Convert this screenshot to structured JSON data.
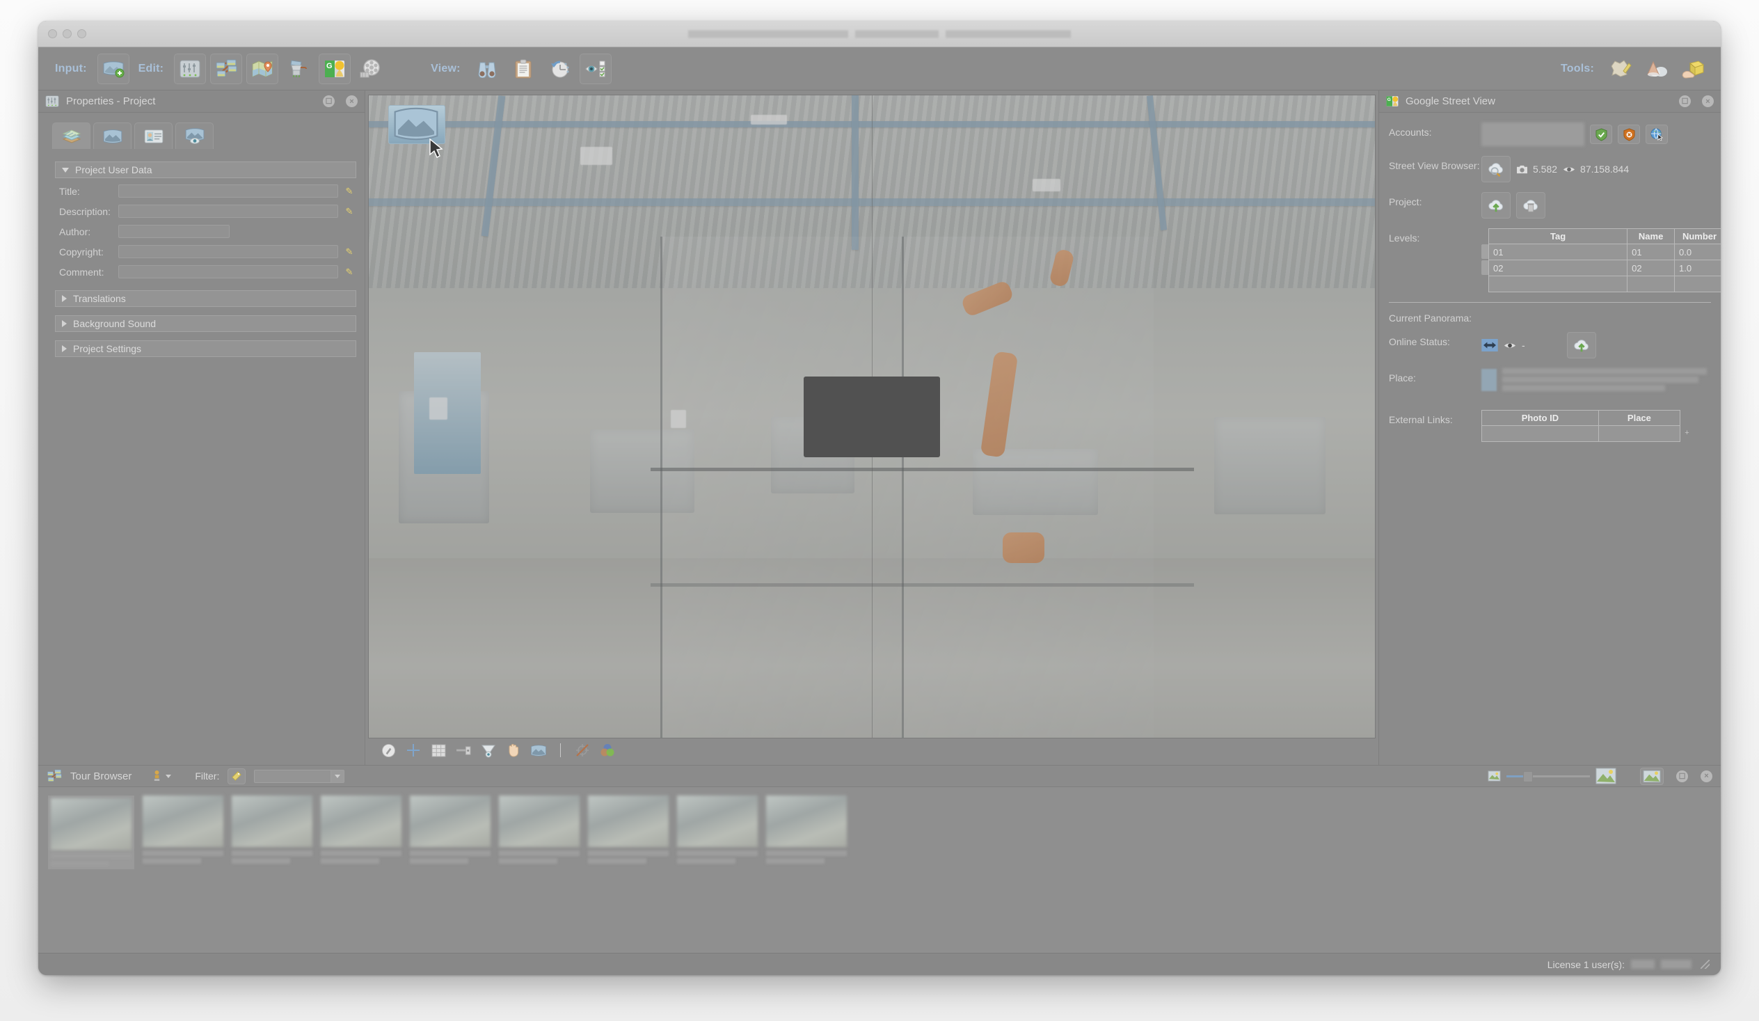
{
  "window": {
    "title_redacted": true,
    "traffic_lights": [
      "close",
      "minimize",
      "zoom"
    ]
  },
  "toolbar": {
    "input_label": "Input:",
    "edit_label": "Edit:",
    "view_label": "View:",
    "tools_label": "Tools:",
    "input_buttons": [
      {
        "name": "add-panorama-input",
        "icon": "panorama-add-icon"
      }
    ],
    "edit_buttons": [
      {
        "name": "properties-button",
        "icon": "sliders-icon"
      },
      {
        "name": "tour-browser-button",
        "icon": "tour-map-icon"
      },
      {
        "name": "map-editor-button",
        "icon": "map-pin-icon"
      },
      {
        "name": "skin-editor-button",
        "icon": "grinder-icon"
      },
      {
        "name": "google-street-view-button",
        "icon": "google-streetview-icon"
      },
      {
        "name": "animation-editor-button",
        "icon": "film-reel-icon"
      }
    ],
    "view_buttons": [
      {
        "name": "viewer-button",
        "icon": "binoculars-icon"
      },
      {
        "name": "output-log-button",
        "icon": "clipboard-icon"
      },
      {
        "name": "history-button",
        "icon": "history-clock-icon"
      },
      {
        "name": "visibility-button",
        "icon": "eye-checklist-icon"
      }
    ],
    "tools_buttons": [
      {
        "name": "patch-tool-button",
        "icon": "patch-pencil-icon"
      },
      {
        "name": "mask-tool-button",
        "icon": "cloud-cone-icon"
      },
      {
        "name": "package-tool-button",
        "icon": "hand-box-icon"
      }
    ]
  },
  "properties_panel": {
    "title": "Properties - Project",
    "header_icon": "sliders-icon",
    "header_buttons": [
      {
        "name": "float-panel-button",
        "icon": "float-window-icon"
      },
      {
        "name": "close-panel-button",
        "icon": "close-icon"
      }
    ],
    "tabs": [
      {
        "name": "tab-project",
        "icon": "layers-stack-icon",
        "active": true
      },
      {
        "name": "tab-panorama",
        "icon": "panorama-icon",
        "active": false
      },
      {
        "name": "tab-user-data",
        "icon": "id-card-icon",
        "active": false
      },
      {
        "name": "tab-viewing-params",
        "icon": "panorama-eye-icon",
        "active": false
      }
    ],
    "sections": [
      {
        "label": "Project User Data",
        "expanded": true
      },
      {
        "label": "Translations",
        "expanded": false
      },
      {
        "label": "Background Sound",
        "expanded": false
      },
      {
        "label": "Project Settings",
        "expanded": false
      }
    ],
    "fields": [
      {
        "label": "Title:",
        "value": "",
        "placeholder": "",
        "has_pencil": true,
        "short": false
      },
      {
        "label": "Description:",
        "value": "",
        "placeholder": "",
        "has_pencil": true,
        "short": false
      },
      {
        "label": "Author:",
        "value": "",
        "placeholder": "",
        "has_pencil": false,
        "short": true
      },
      {
        "label": "Copyright:",
        "value": "",
        "placeholder": "",
        "has_pencil": true,
        "short": false
      },
      {
        "label": "Comment:",
        "value": "",
        "placeholder": "",
        "has_pencil": true,
        "short": false
      }
    ]
  },
  "viewer": {
    "toolbar_buttons": [
      {
        "name": "compass-button",
        "icon": "compass-icon"
      },
      {
        "name": "crosshair-button",
        "icon": "crosshair-icon"
      },
      {
        "name": "grid-button",
        "icon": "grid-icon"
      },
      {
        "name": "level-button",
        "icon": "level-bar-icon"
      },
      {
        "name": "viewing-cone-button",
        "icon": "view-cone-icon"
      },
      {
        "name": "pan-hand-button",
        "icon": "hand-icon"
      },
      {
        "name": "panorama-button",
        "icon": "panorama-icon"
      },
      {
        "name": "no-target-button",
        "icon": "target-off-icon"
      },
      {
        "name": "color-button",
        "icon": "color-circles-icon"
      }
    ],
    "scene": {
      "type": "industrial-hall-panorama",
      "hotspot_label": "panorama-thumbnail-hotspot",
      "redacted_overlay": true
    }
  },
  "gsv_panel": {
    "title": "Google Street View",
    "header_icon": "google-streetview-icon",
    "header_buttons": [
      {
        "name": "float-panel-button",
        "icon": "float-window-icon"
      },
      {
        "name": "close-panel-button",
        "icon": "close-icon"
      }
    ],
    "accounts": {
      "label": "Accounts:",
      "value_redacted": true,
      "buttons": [
        {
          "name": "account-authorize-button",
          "icon": "shield-check-icon",
          "color": "#6aa84f"
        },
        {
          "name": "account-revoke-button",
          "icon": "shield-cancel-icon",
          "color": "#cf7120"
        },
        {
          "name": "account-open-browser-button",
          "icon": "globe-cursor-icon",
          "color": "#5b9bd5"
        }
      ]
    },
    "street_view_browser": {
      "label": "Street View Browser:",
      "button": {
        "name": "streetview-browser-button",
        "icon": "cloud-search-icon"
      },
      "photo_count_icon": "camera-icon",
      "photo_count": "5.582",
      "views_icon": "eye-icon",
      "views": "87.158.844"
    },
    "project": {
      "label": "Project:",
      "buttons": [
        {
          "name": "upload-project-button",
          "icon": "cloud-upload-icon"
        },
        {
          "name": "delete-project-button",
          "icon": "cloud-trash-icon"
        }
      ]
    },
    "levels": {
      "label": "Levels:",
      "columns": [
        "Tag",
        "Name",
        "Number"
      ],
      "rows": [
        {
          "tag": "01",
          "name": "01",
          "number": "0.0"
        },
        {
          "tag": "02",
          "name": "02",
          "number": "1.0"
        },
        {
          "tag": "",
          "name": "",
          "number": ""
        }
      ],
      "row_buttons": [
        {
          "name": "delete-level-row-button",
          "icon": "delete-circle-icon"
        },
        {
          "name": "delete-level-row-button",
          "icon": "delete-circle-icon"
        },
        {
          "name": "add-level-row-button",
          "icon": "plus-icon"
        }
      ]
    },
    "current_panorama": {
      "label": "Current Panorama:",
      "online_status": {
        "label": "Online Status:",
        "connection_icon": "connection-icon",
        "views_icon": "eye-icon",
        "views_value": "-",
        "upload_button": {
          "name": "upload-panorama-button",
          "icon": "cloud-upload-icon"
        }
      },
      "place": {
        "label": "Place:",
        "thumbnail_redacted": true,
        "value_redacted": true
      },
      "external_links": {
        "label": "External Links:",
        "columns": [
          "Photo ID",
          "Place"
        ],
        "rows": [
          {
            "photo_id": "",
            "place": ""
          }
        ],
        "add_button": {
          "name": "add-external-link-button",
          "icon": "plus-icon"
        }
      }
    }
  },
  "tour_browser": {
    "title": "Tour Browser",
    "header_icon": "tour-map-icon",
    "sort_button": {
      "name": "sort-mode-button",
      "icon": "pin-person-icon"
    },
    "filter_label": "Filter:",
    "filter_button": {
      "name": "filter-tag-button",
      "icon": "tag-pencil-icon"
    },
    "filter_value": "",
    "filter_placeholder": "",
    "zoom_slider": {
      "small_icon": "small-thumbnail-icon",
      "large_icon": "large-thumbnail-icon",
      "value": 20
    },
    "view_mode_button": {
      "name": "thumbnail-view-button",
      "icon": "image-view-icon"
    },
    "header_buttons": [
      {
        "name": "float-panel-button",
        "icon": "float-window-icon"
      },
      {
        "name": "close-panel-button",
        "icon": "close-icon"
      }
    ],
    "thumbnails": [
      {
        "name": "tour-node-1",
        "selected": true,
        "label_redacted": true
      },
      {
        "name": "tour-node-2",
        "selected": false,
        "label_redacted": true
      },
      {
        "name": "tour-node-3",
        "selected": false,
        "label_redacted": true
      },
      {
        "name": "tour-node-4",
        "selected": false,
        "label_redacted": true
      },
      {
        "name": "tour-node-5",
        "selected": false,
        "label_redacted": true
      },
      {
        "name": "tour-node-6",
        "selected": false,
        "label_redacted": true
      },
      {
        "name": "tour-node-7",
        "selected": false,
        "label_redacted": true
      },
      {
        "name": "tour-node-8",
        "selected": false,
        "label_redacted": true
      },
      {
        "name": "tour-node-9",
        "selected": false,
        "label_redacted": true
      }
    ]
  },
  "status_bar": {
    "license_text": "License 1 user(s):",
    "license_value_redacted": true
  },
  "colors": {
    "window_bg": "#8a8a8a",
    "panel_bg": "#8b8b8b",
    "toolbar_label": "#a9c0d8",
    "text": "#d6d6d6",
    "accent_green": "#6aa84f",
    "accent_orange": "#cf7120",
    "accent_blue": "#5b9bd5"
  }
}
